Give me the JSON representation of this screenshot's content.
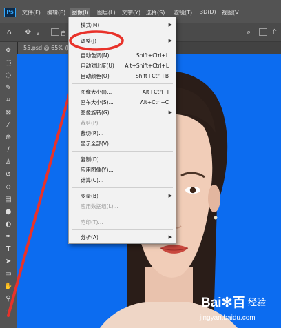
{
  "app": {
    "logo": "Ps"
  },
  "menubar": {
    "items": [
      "文件(F)",
      "编辑(E)",
      "图像(I)",
      "图层(L)",
      "文字(Y)",
      "选择(S)",
      "滤镜(T)",
      "3D(D)",
      "视图(V"
    ],
    "active": "图像(I)"
  },
  "options": {
    "auto_select_label": "自",
    "icons": [
      "home-icon",
      "move-icon",
      "chevron-down-icon",
      "search-icon",
      "workspace-icon",
      "share-icon"
    ]
  },
  "document": {
    "tab_label": "55.psd @ 65% (图"
  },
  "image_menu": {
    "items": [
      {
        "label": "模式(M)",
        "shortcut": "",
        "submenu": true,
        "disabled": false
      },
      {
        "label": "调整(J)",
        "shortcut": "",
        "submenu": true,
        "disabled": false
      },
      {
        "label": "自动色调(N)",
        "shortcut": "Shift+Ctrl+L",
        "submenu": false,
        "disabled": false
      },
      {
        "label": "自动对比度(U)",
        "shortcut": "Alt+Shift+Ctrl+L",
        "submenu": false,
        "disabled": false
      },
      {
        "label": "自动颜色(O)",
        "shortcut": "Shift+Ctrl+B",
        "submenu": false,
        "disabled": false
      },
      {
        "label": "图像大小(I)...",
        "shortcut": "Alt+Ctrl+I",
        "submenu": false,
        "disabled": false
      },
      {
        "label": "画布大小(S)...",
        "shortcut": "Alt+Ctrl+C",
        "submenu": false,
        "disabled": false
      },
      {
        "label": "图像旋转(G)",
        "shortcut": "",
        "submenu": true,
        "disabled": false
      },
      {
        "label": "裁剪(P)",
        "shortcut": "",
        "submenu": false,
        "disabled": true
      },
      {
        "label": "裁切(R)...",
        "shortcut": "",
        "submenu": false,
        "disabled": false
      },
      {
        "label": "显示全部(V)",
        "shortcut": "",
        "submenu": false,
        "disabled": false
      },
      {
        "label": "复制(D)...",
        "shortcut": "",
        "submenu": false,
        "disabled": false
      },
      {
        "label": "应用图像(Y)...",
        "shortcut": "",
        "submenu": false,
        "disabled": false
      },
      {
        "label": "计算(C)...",
        "shortcut": "",
        "submenu": false,
        "disabled": false
      },
      {
        "label": "变量(B)",
        "shortcut": "",
        "submenu": true,
        "disabled": false
      },
      {
        "label": "应用数据组(L)...",
        "shortcut": "",
        "submenu": false,
        "disabled": true
      },
      {
        "label": "陷印(T)...",
        "shortcut": "",
        "submenu": false,
        "disabled": true
      },
      {
        "label": "分析(A)",
        "shortcut": "",
        "submenu": true,
        "disabled": false
      }
    ]
  },
  "toolbar": {
    "tools": [
      "move-tool",
      "marquee-tool",
      "lasso-tool",
      "quick-select-tool",
      "crop-tool",
      "frame-tool",
      "eyedropper-tool",
      "healing-brush-tool",
      "brush-tool",
      "clone-stamp-tool",
      "history-brush-tool",
      "eraser-tool",
      "gradient-tool",
      "blur-tool",
      "dodge-tool",
      "pen-tool",
      "type-tool",
      "path-select-tool",
      "rectangle-tool",
      "hand-tool",
      "zoom-tool",
      "more-tools"
    ]
  },
  "watermark": {
    "brand": "Bai",
    "brand_end": "百",
    "suffix": "经验",
    "url": "jingyan.baidu.com"
  },
  "colors": {
    "canvas": "#0c6cf0",
    "annotation": "#e8322a",
    "menubar": "#535353",
    "menu_bg": "#f2f2f2"
  }
}
